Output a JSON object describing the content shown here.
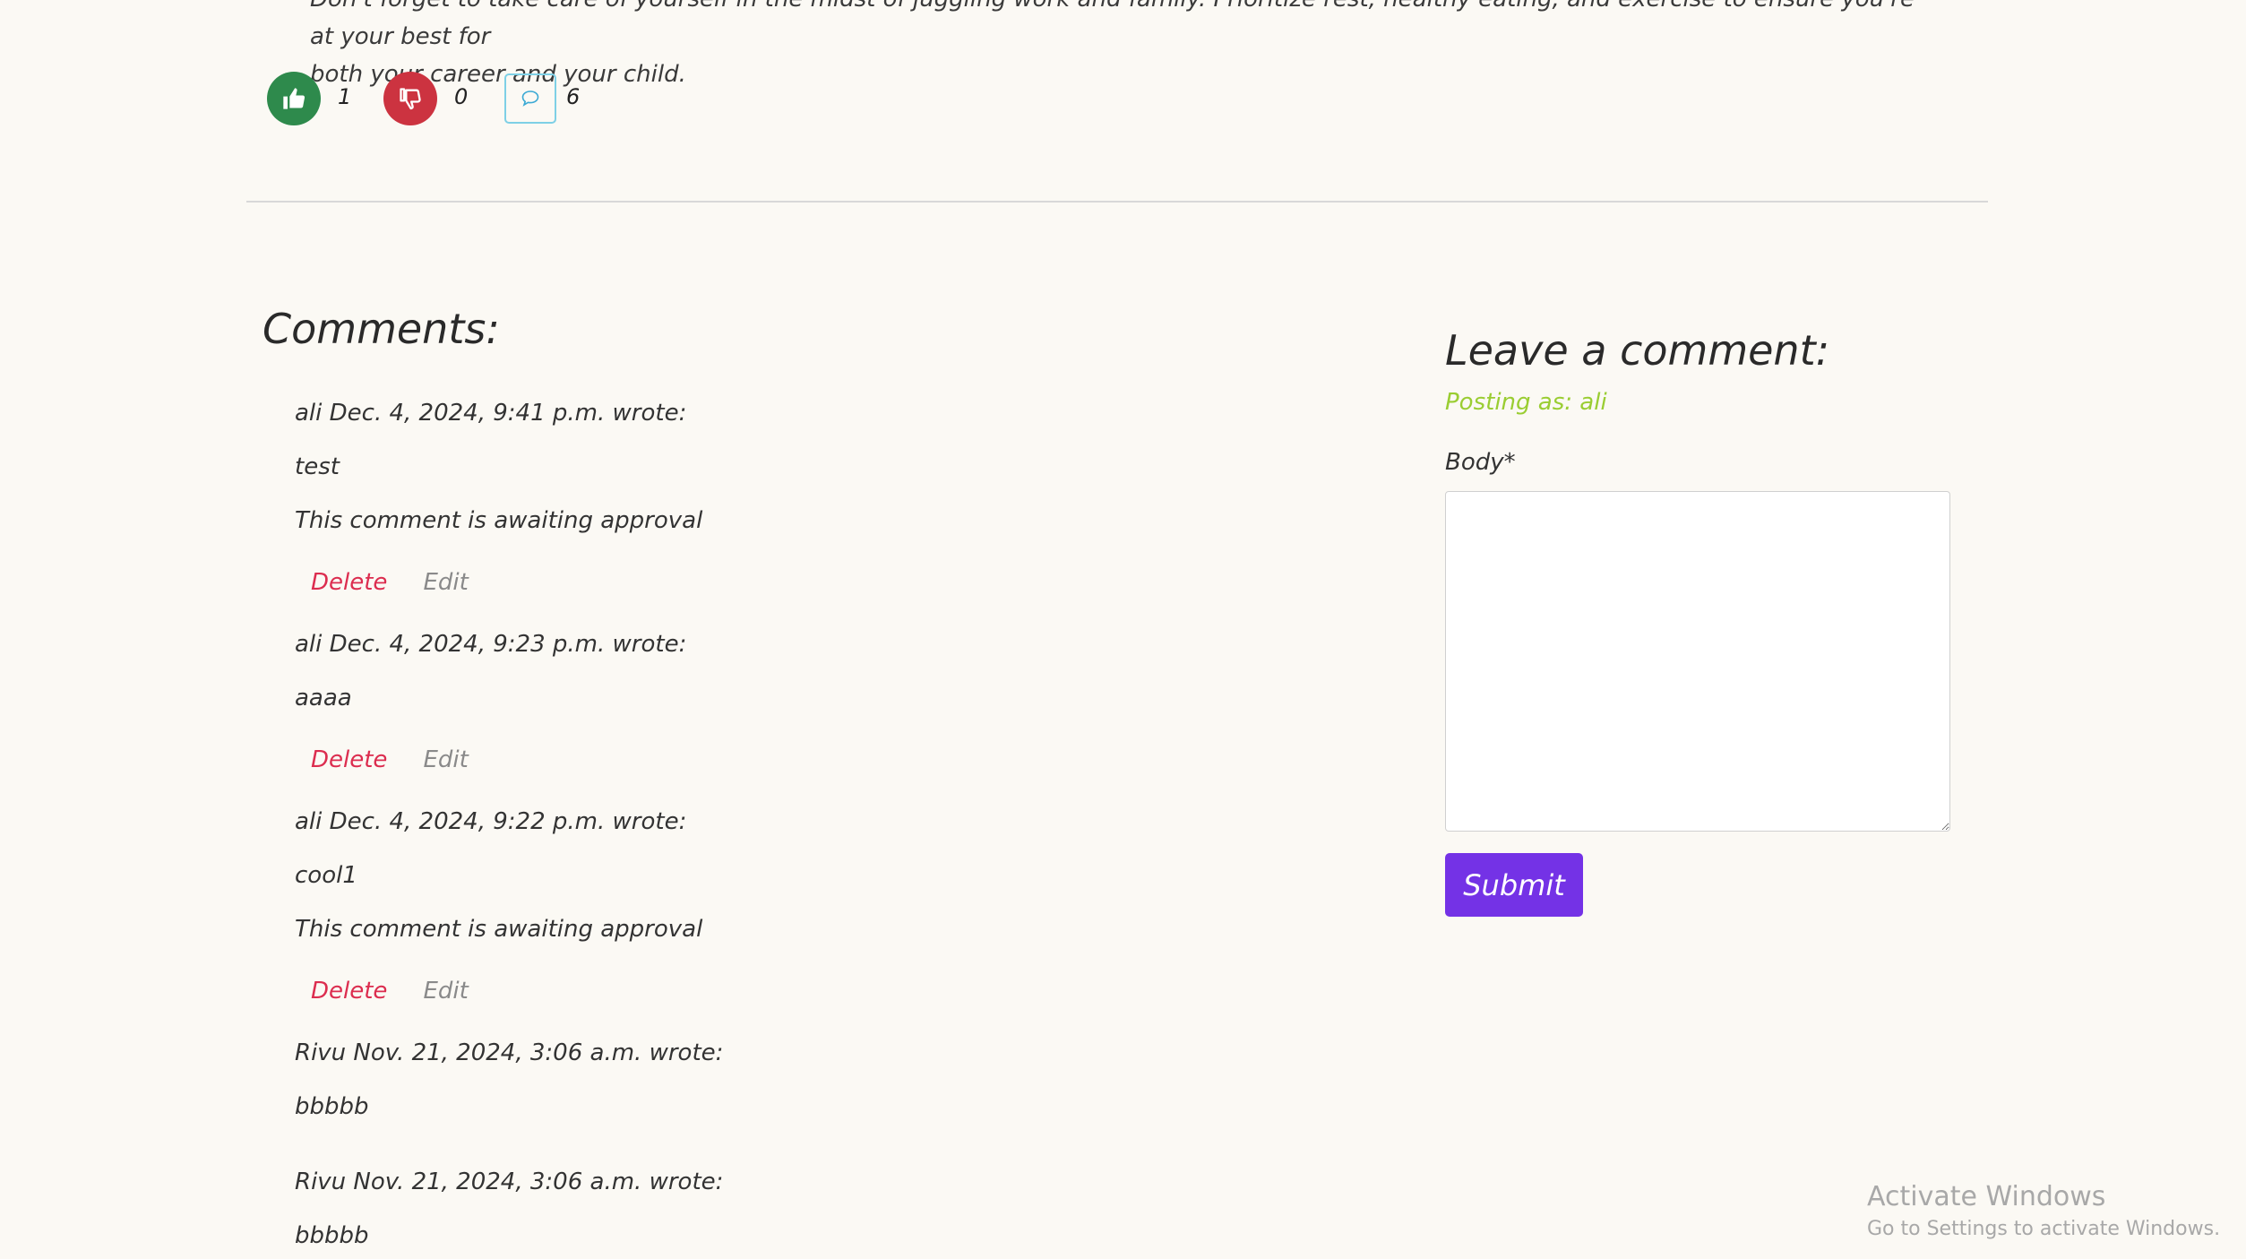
{
  "post": {
    "intro_line1": "Don't forget to take care of yourself in the midst of juggling work and family. Prioritize rest, healthy eating, and exercise to ensure you're at your best for",
    "intro_line2": "both your career and your child."
  },
  "reactions": {
    "likes": "1",
    "dislikes": "0",
    "comments": "6",
    "like_color": "#2e8a4c",
    "dislike_color": "#cc3340",
    "comment_border": "#7ed0e6"
  },
  "comments_section": {
    "title": "Comments:",
    "items": [
      {
        "header": "ali Dec. 4, 2024, 9:41 p.m. wrote:",
        "body": "test",
        "status": "This comment is awaiting approval",
        "delete": "Delete",
        "edit": "Edit"
      },
      {
        "header": "ali Dec. 4, 2024, 9:23 p.m. wrote:",
        "body": "aaaa",
        "delete": "Delete",
        "edit": "Edit"
      },
      {
        "header": "ali Dec. 4, 2024, 9:22 p.m. wrote:",
        "body": "cool1",
        "status": "This comment is awaiting approval",
        "delete": "Delete",
        "edit": "Edit"
      },
      {
        "header": "Rivu Nov. 21, 2024, 3:06 a.m. wrote:",
        "body": "bbbbb"
      },
      {
        "header": "Rivu Nov. 21, 2024, 3:06 a.m. wrote:",
        "body": "bbbbb"
      }
    ]
  },
  "comment_form": {
    "title": "Leave a comment:",
    "posting_as": "Posting as: ali",
    "body_label": "Body*",
    "submit_label": "Submit"
  },
  "watermark": {
    "title": "Activate Windows",
    "subtitle": "Go to Settings to activate Windows."
  }
}
